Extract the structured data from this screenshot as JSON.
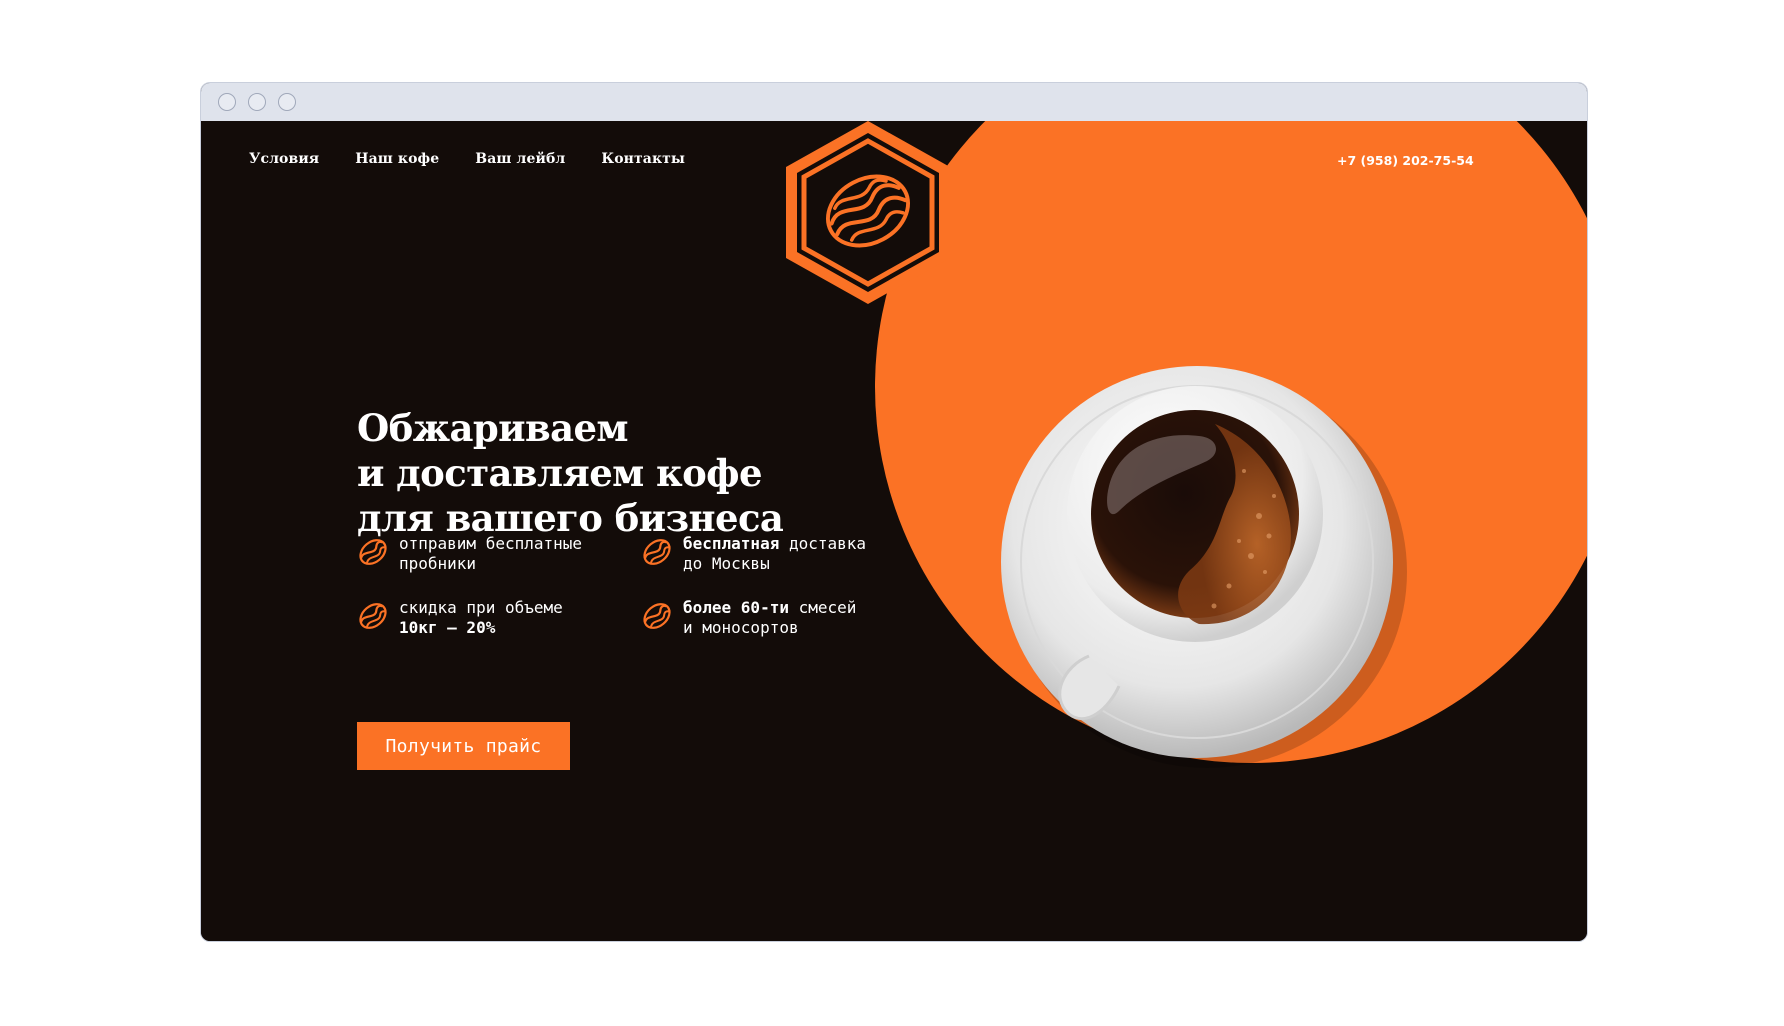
{
  "header": {
    "nav": [
      "Условия",
      "Наш кофе",
      "Ваш лейбл",
      "Контакты"
    ],
    "phone": "+7 (958) 202-75-54"
  },
  "hero": {
    "title_lines": [
      "Обжариваем",
      "и доставляем кофе",
      "для вашего бизнеса"
    ],
    "features": [
      {
        "icon": "coffee-bean-icon",
        "line1_regular": "отправим бесплатные",
        "line2_regular": "пробники"
      },
      {
        "icon": "coffee-bean-icon",
        "line1_bold": "бесплатная",
        "line1_regular": " доставка",
        "line2_regular": "до Москвы"
      },
      {
        "icon": "coffee-bean-icon",
        "line1_regular": "скидка при объеме",
        "line2_bold": "10кг — 20%"
      },
      {
        "icon": "coffee-bean-icon",
        "line1_bold": "более 60-ти",
        "line1_regular": " смесей",
        "line2_regular": "и моносортов"
      }
    ],
    "cta_label": "Получить прайс"
  },
  "colors": {
    "accent": "#fb7225",
    "background": "#130c09",
    "text": "#ffffff",
    "browser_chrome": "#dfe3ec"
  }
}
